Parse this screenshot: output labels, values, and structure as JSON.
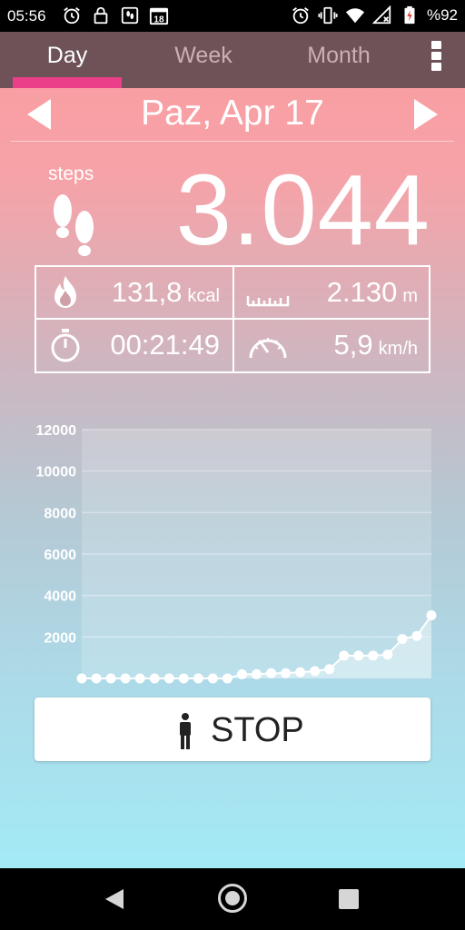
{
  "status_bar": {
    "time": "05:56",
    "notification_icons": [
      "alarm-icon",
      "lock-icon",
      "pedometer-icon",
      "calendar-18-icon"
    ],
    "system_icons": [
      "alarm-icon",
      "vibrate-icon",
      "wifi-icon",
      "no-signal-icon",
      "battery-charging-icon"
    ],
    "battery": "%92",
    "calendar_day": "18"
  },
  "tabs": [
    {
      "label": "Day",
      "active": true
    },
    {
      "label": "Week",
      "active": false
    },
    {
      "label": "Month",
      "active": false
    }
  ],
  "accent_color": "#ec3f8a",
  "date": {
    "label": "Paz, Apr 17"
  },
  "steps": {
    "caption": "steps",
    "value": "3.044"
  },
  "stats": {
    "calories": {
      "value": "131,8",
      "unit": "kcal",
      "icon": "flame-icon"
    },
    "distance": {
      "value": "2.130",
      "unit": "m",
      "icon": "ruler-icon"
    },
    "duration": {
      "value": "00:21:49",
      "icon": "stopwatch-icon"
    },
    "speed": {
      "value": "5,9",
      "unit": "km/h",
      "icon": "speedometer-icon"
    }
  },
  "chart_data": {
    "type": "line",
    "title": "",
    "xlabel": "",
    "ylabel": "",
    "x": [
      0,
      1,
      2,
      3,
      4,
      5,
      6,
      7,
      8,
      9,
      10,
      11,
      12,
      13,
      14,
      15,
      16,
      17,
      18,
      19,
      20,
      21,
      22,
      23,
      24
    ],
    "series": [
      {
        "values": [
          0,
          0,
          0,
          0,
          0,
          0,
          0,
          0,
          0,
          0,
          0,
          200,
          200,
          250,
          250,
          300,
          350,
          450,
          1100,
          1100,
          1100,
          1150,
          1900,
          2050,
          3044
        ]
      }
    ],
    "ylim": [
      0,
      12000
    ],
    "xlim": [
      0,
      24
    ],
    "yticks": [
      2000,
      4000,
      6000,
      8000,
      10000,
      12000
    ],
    "xticks": [
      2,
      4,
      6,
      8,
      10,
      12,
      14,
      16,
      18,
      20,
      22,
      24
    ],
    "grid": true
  },
  "stop_button": {
    "label": "STOP",
    "icon": "walking-person-icon"
  },
  "nav_bar": {
    "buttons": [
      "back-icon",
      "home-icon",
      "recents-icon"
    ]
  }
}
